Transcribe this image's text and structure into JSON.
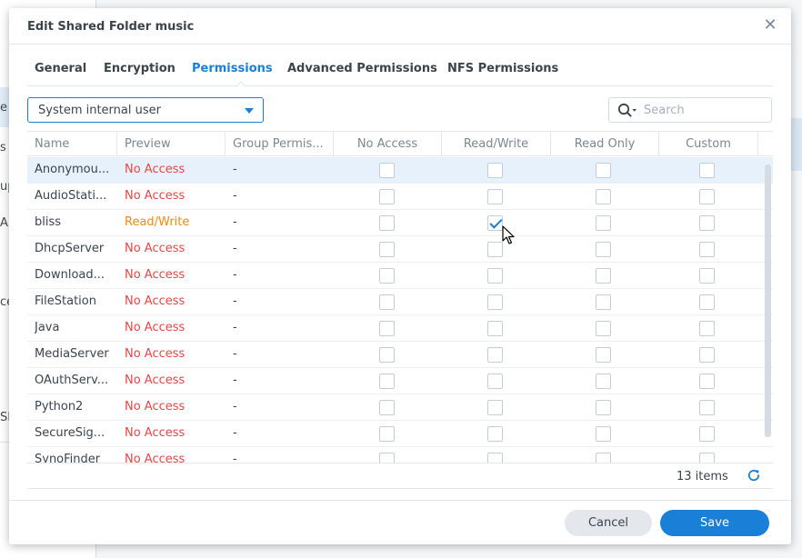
{
  "background": {
    "fragments": [
      "e",
      "s",
      "up",
      "AF",
      "ce",
      "SH"
    ]
  },
  "dialog": {
    "title": "Edit Shared Folder music",
    "close_glyph": "✕",
    "tabs": [
      {
        "label": "General"
      },
      {
        "label": "Encryption"
      },
      {
        "label": "Permissions"
      },
      {
        "label": "Advanced Permissions"
      },
      {
        "label": "NFS Permissions"
      }
    ],
    "active_tab": "Permissions",
    "user_type": {
      "value": "System internal user"
    },
    "search": {
      "placeholder": "Search"
    },
    "grid": {
      "columns": [
        "Name",
        "Preview",
        "Group Permis...",
        "No Access",
        "Read/Write",
        "Read Only",
        "Custom"
      ],
      "rows": [
        {
          "name": "Anonymou...",
          "preview": "No Access",
          "group": "-",
          "no_access": false,
          "read_write": false,
          "read_only": false,
          "custom": false
        },
        {
          "name": "AudioStati...",
          "preview": "No Access",
          "group": "-",
          "no_access": false,
          "read_write": false,
          "read_only": false,
          "custom": false
        },
        {
          "name": "bliss",
          "preview": "Read/Write",
          "group": "-",
          "no_access": false,
          "read_write": true,
          "read_only": false,
          "custom": false
        },
        {
          "name": "DhcpServer",
          "preview": "No Access",
          "group": "-",
          "no_access": false,
          "read_write": false,
          "read_only": false,
          "custom": false
        },
        {
          "name": "Download...",
          "preview": "No Access",
          "group": "-",
          "no_access": false,
          "read_write": false,
          "read_only": false,
          "custom": false
        },
        {
          "name": "FileStation",
          "preview": "No Access",
          "group": "-",
          "no_access": false,
          "read_write": false,
          "read_only": false,
          "custom": false
        },
        {
          "name": "Java",
          "preview": "No Access",
          "group": "-",
          "no_access": false,
          "read_write": false,
          "read_only": false,
          "custom": false
        },
        {
          "name": "MediaServer",
          "preview": "No Access",
          "group": "-",
          "no_access": false,
          "read_write": false,
          "read_only": false,
          "custom": false
        },
        {
          "name": "OAuthServ...",
          "preview": "No Access",
          "group": "-",
          "no_access": false,
          "read_write": false,
          "read_only": false,
          "custom": false
        },
        {
          "name": "Python2",
          "preview": "No Access",
          "group": "-",
          "no_access": false,
          "read_write": false,
          "read_only": false,
          "custom": false
        },
        {
          "name": "SecureSig...",
          "preview": "No Access",
          "group": "-",
          "no_access": false,
          "read_write": false,
          "read_only": false,
          "custom": false
        },
        {
          "name": "SynoFinder",
          "preview": "No Access",
          "group": "-",
          "no_access": false,
          "read_write": false,
          "read_only": false,
          "custom": false
        }
      ],
      "selected_row": 0
    },
    "footer": {
      "items_count": "13 items"
    },
    "buttons": {
      "cancel": "Cancel",
      "save": "Save"
    }
  },
  "colors": {
    "accent": "#1a7fd6",
    "no_access": "#e64646",
    "read_write": "#ee8a14"
  },
  "icons": {
    "search": "search-icon",
    "dropdown": "chevron-down-icon",
    "refresh": "refresh-icon",
    "close": "close-icon",
    "cursor": "mouse-pointer-icon"
  }
}
